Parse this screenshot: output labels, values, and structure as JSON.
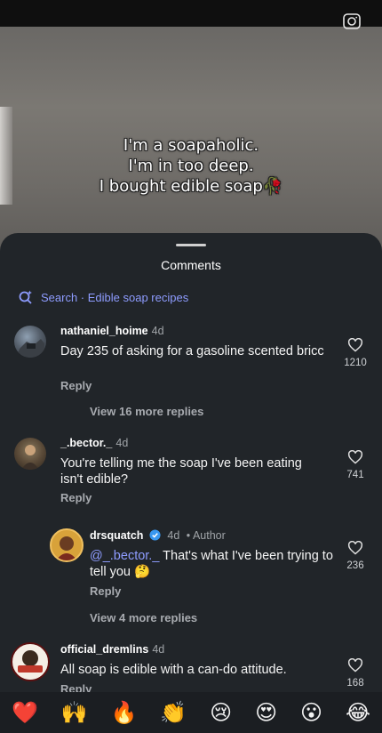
{
  "video": {
    "caption_lines": [
      "I'm a soapaholic.",
      "I'm in too deep.",
      "I bought edible soap🥀"
    ]
  },
  "sheet": {
    "title": "Comments",
    "search_label": "Search · Edible soap recipes"
  },
  "comments": [
    {
      "username": "nathaniel_hoime",
      "time": "4d",
      "text": "Day 235 of asking for a gasoline scented bricc",
      "reply_label": "Reply",
      "likes": "1210",
      "more_replies": "View 16 more replies"
    },
    {
      "username": "_.bector._",
      "time": "4d",
      "text": "You're telling me the soap I've been eating isn't edible?",
      "reply_label": "Reply",
      "likes": "741"
    },
    {
      "username": "drsquatch",
      "time": "4d",
      "author_tag": "• Author",
      "mention": "@_.bector._",
      "text": " That's what I've been trying to tell you 🤔",
      "reply_label": "Reply",
      "likes": "236",
      "more_replies": "View 4 more replies"
    },
    {
      "username": "official_dremlins",
      "time": "4d",
      "text": "All soap is edible with a can-do attitude.",
      "reply_label": "Reply",
      "likes": "168"
    }
  ],
  "emoji_bar": [
    "❤️",
    "🙌",
    "🔥",
    "👏",
    "😢",
    "😍",
    "😮",
    "😂"
  ],
  "colors": {
    "sheet_bg": "#212529",
    "accent_link": "#8e9cff",
    "verified_blue": "#3897f0"
  }
}
